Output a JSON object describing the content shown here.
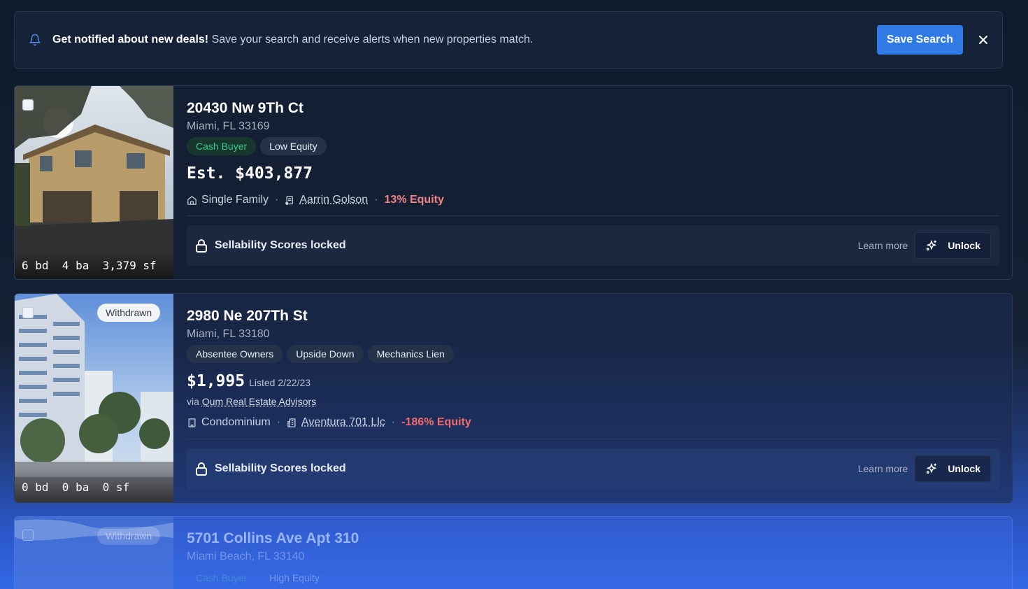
{
  "banner": {
    "title": "Get notified about new deals!",
    "message": "Save your search and receive alerts when new properties match.",
    "save_label": "Save Search"
  },
  "listings": [
    {
      "status": "",
      "stats": "6 bd  4 ba  3,379 sf",
      "address": "20430 Nw 9Th Ct",
      "city": "Miami, FL 33169",
      "tags": [
        "Cash Buyer",
        "Low Equity"
      ],
      "price": "Est. $403,877",
      "listed": "",
      "via_prefix": "",
      "via_agent": "",
      "property_type": "Single Family",
      "owner": "Aarrin Golson",
      "equity": "13% Equity",
      "locked_text": "Sellability Scores locked",
      "learn_more": "Learn more",
      "unlock_label": "Unlock"
    },
    {
      "status": "Withdrawn",
      "stats": "0 bd  0 ba  0 sf",
      "address": "2980 Ne 207Th St",
      "city": "Miami, FL 33180",
      "tags": [
        "Absentee Owners",
        "Upside Down",
        "Mechanics Lien"
      ],
      "price": "$1,995",
      "listed": "Listed 2/22/23",
      "via_prefix": "via ",
      "via_agent": "Qum Real Estate Advisors",
      "property_type": "Condominium",
      "owner": "Aventura 701 Llc",
      "equity": "-186% Equity",
      "locked_text": "Sellability Scores locked",
      "learn_more": "Learn more",
      "unlock_label": "Unlock"
    },
    {
      "status": "Withdrawn",
      "address": "5701 Collins Ave Apt 310",
      "city": "Miami Beach, FL 33140",
      "tags": [
        "Cash Buyer",
        "High Equity"
      ]
    }
  ],
  "colors": {
    "accent": "#2f7ae5",
    "equity_low": "#f08585",
    "cash_buyer": "#38c98a"
  },
  "icons": [
    "bell-icon",
    "close-icon",
    "home-icon",
    "deed-icon",
    "building-icon",
    "lock-icon",
    "sparkle-icon"
  ]
}
